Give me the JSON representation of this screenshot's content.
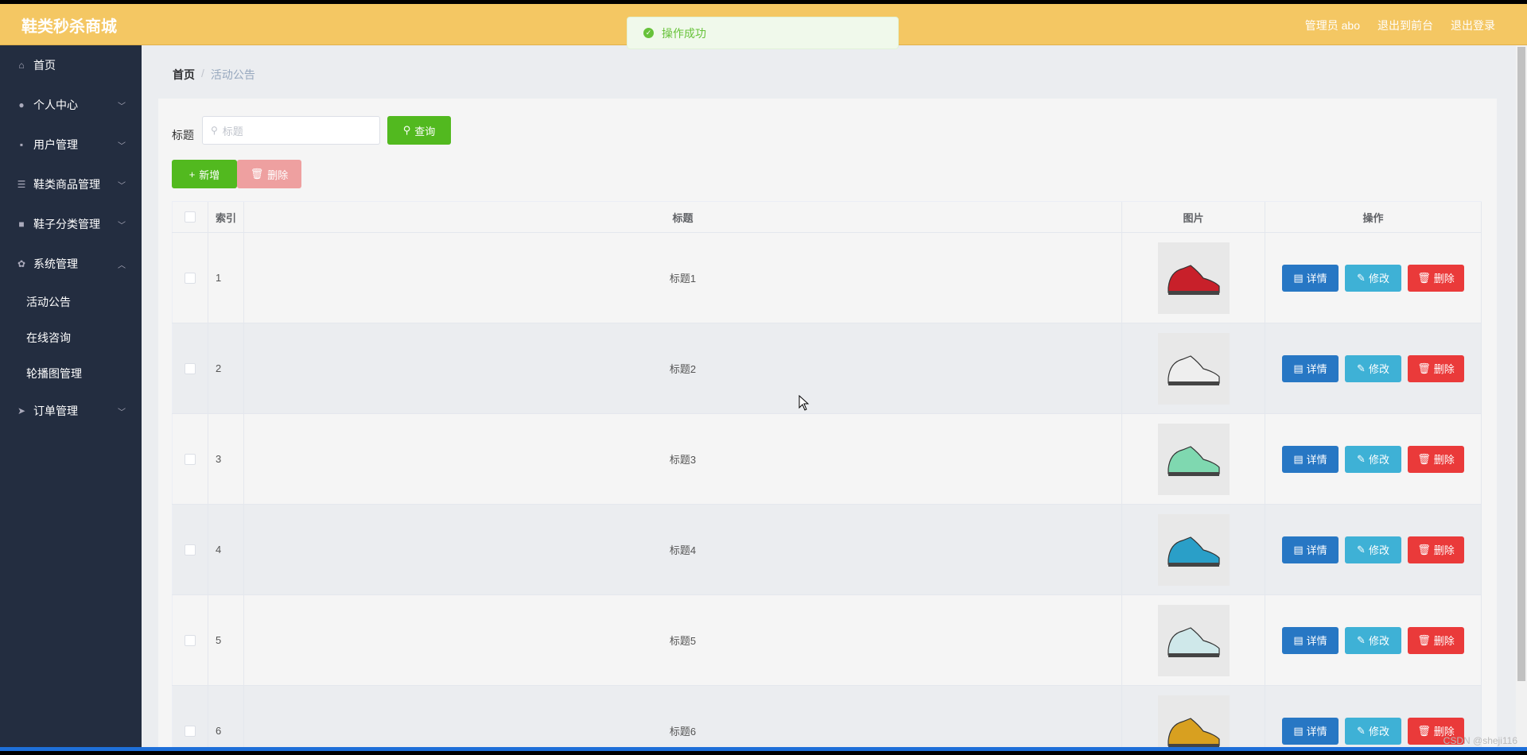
{
  "header": {
    "brand": "鞋类秒杀商城",
    "user": "管理员 abo",
    "back_front": "退出到前台",
    "logout": "退出登录"
  },
  "toast": {
    "message": "操作成功"
  },
  "sidebar": {
    "items": [
      {
        "label": "首页",
        "icon": "home-icon"
      },
      {
        "label": "个人中心",
        "icon": "user-icon"
      },
      {
        "label": "用户管理",
        "icon": "users-icon"
      },
      {
        "label": "鞋类商品管理",
        "icon": "list-icon"
      },
      {
        "label": "鞋子分类管理",
        "icon": "briefcase-icon"
      },
      {
        "label": "系统管理",
        "icon": "gear-icon"
      },
      {
        "label": "订单管理",
        "icon": "send-icon"
      }
    ],
    "sub_items": [
      {
        "label": "活动公告"
      },
      {
        "label": "在线咨询"
      },
      {
        "label": "轮播图管理"
      }
    ]
  },
  "breadcrumb": {
    "home": "首页",
    "separator": "/",
    "current": "活动公告"
  },
  "search": {
    "label": "标题",
    "placeholder": "标题",
    "query_button": "查询"
  },
  "actions": {
    "add": "新增",
    "delete": "删除"
  },
  "table": {
    "headers": {
      "index": "索引",
      "title": "标题",
      "image": "图片",
      "ops": "操作"
    },
    "op_labels": {
      "detail": "详情",
      "edit": "修改",
      "delete": "删除"
    },
    "rows": [
      {
        "index": "1",
        "title": "标题1",
        "shoe_color": "#c8202a"
      },
      {
        "index": "2",
        "title": "标题2",
        "shoe_color": "#eeeeee"
      },
      {
        "index": "3",
        "title": "标题3",
        "shoe_color": "#7fd8b0"
      },
      {
        "index": "4",
        "title": "标题4",
        "shoe_color": "#2a9fc8"
      },
      {
        "index": "5",
        "title": "标题5",
        "shoe_color": "#cfe8ea"
      },
      {
        "index": "6",
        "title": "标题6",
        "shoe_color": "#d8a020"
      }
    ]
  },
  "watermark": "CSDN @sheji116"
}
